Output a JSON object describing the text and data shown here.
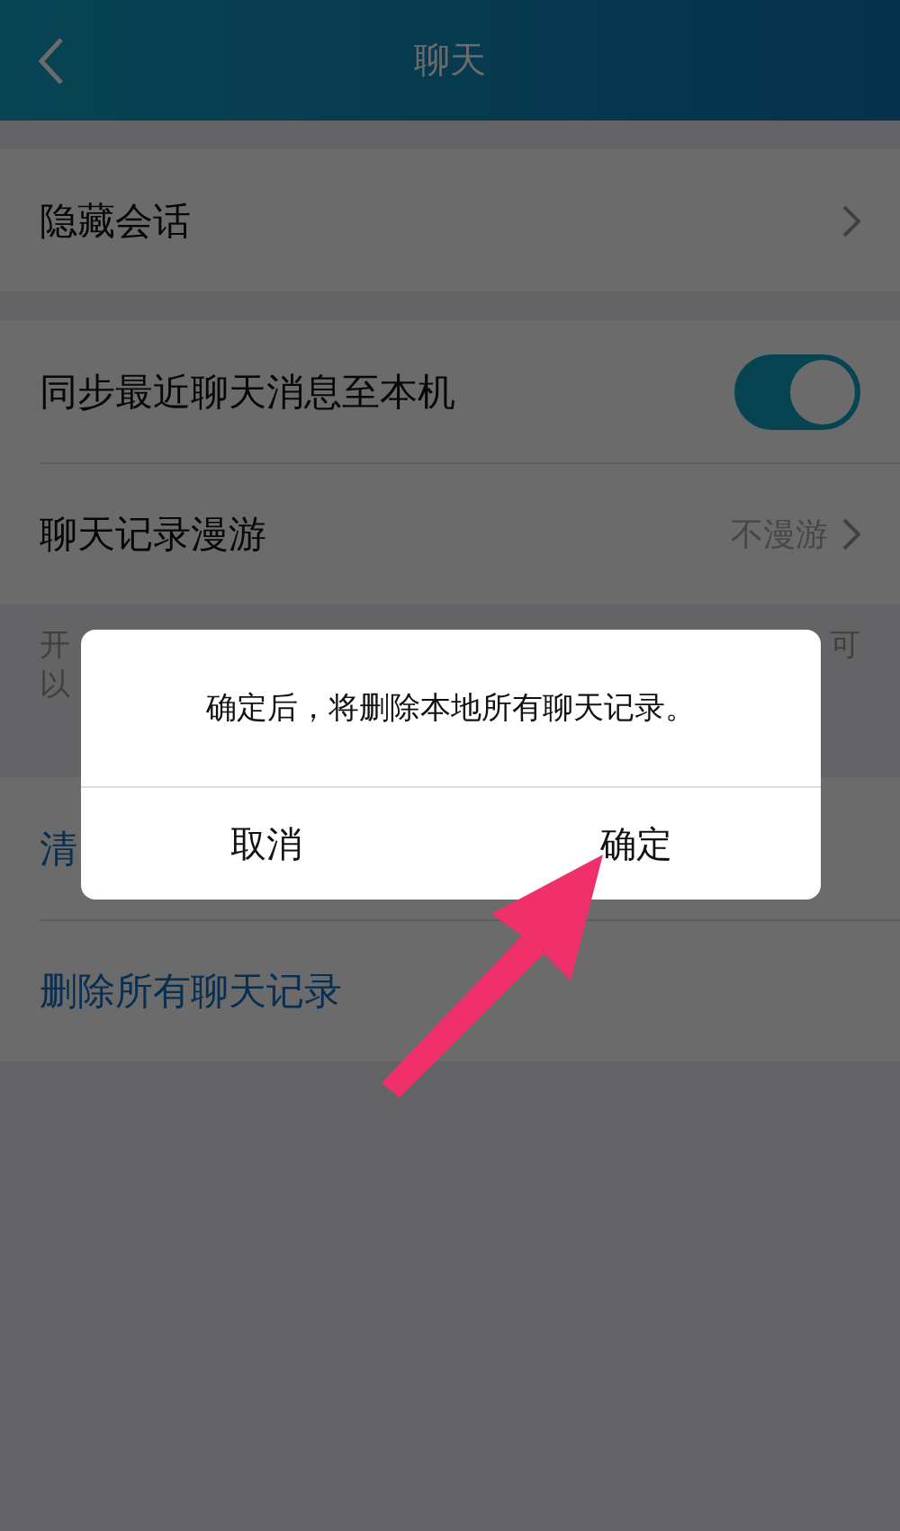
{
  "header": {
    "title": "聊天"
  },
  "sections": [
    {
      "rows": [
        {
          "kind": "chevron",
          "label": "隐藏会话"
        }
      ]
    },
    {
      "rows": [
        {
          "kind": "toggle",
          "label": "同步最近聊天消息至本机",
          "on": true
        },
        {
          "kind": "value",
          "label": "聊天记录漫游",
          "value": "不漫游"
        }
      ],
      "note": {
        "left_lines": [
          "开",
          "以"
        ],
        "right_lines": [
          "可"
        ]
      }
    },
    {
      "rows": [
        {
          "kind": "action",
          "label": "清"
        },
        {
          "kind": "action",
          "label": "删除所有聊天记录"
        }
      ]
    }
  ],
  "dialog": {
    "message": "确定后，将删除本地所有聊天记录。",
    "buttons": [
      {
        "label": "取消"
      },
      {
        "label": "确定"
      }
    ]
  }
}
